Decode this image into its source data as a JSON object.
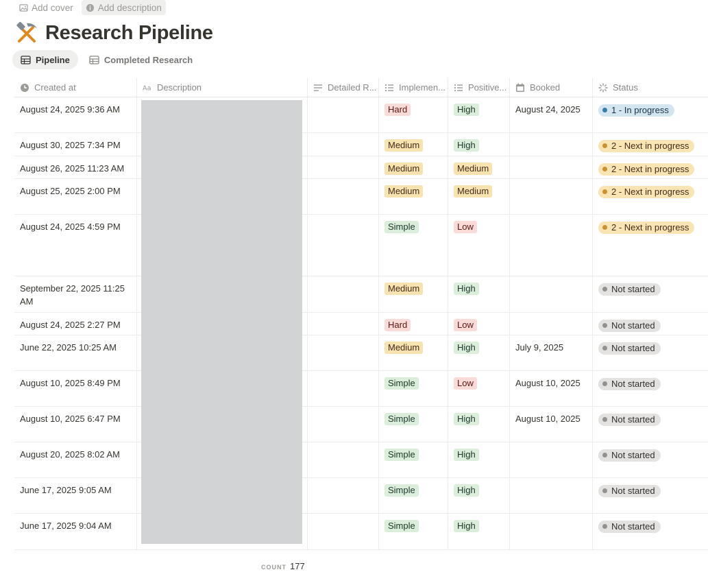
{
  "page_actions": {
    "add_cover": "Add cover",
    "add_description": "Add description"
  },
  "page": {
    "title": "Research Pipeline",
    "icon": "hammer-and-pick-icon"
  },
  "views": [
    {
      "label": "Pipeline",
      "active": true
    },
    {
      "label": "Completed Research",
      "active": false
    }
  ],
  "columns": [
    {
      "label": "Created at",
      "icon": "clock-icon"
    },
    {
      "label": "Description",
      "icon": "text-aa-icon"
    },
    {
      "label": "Detailed R...",
      "icon": "text-lines-icon"
    },
    {
      "label": "Implemen...",
      "icon": "list-icon"
    },
    {
      "label": "Positive...",
      "icon": "list-icon"
    },
    {
      "label": "Booked",
      "icon": "calendar-icon"
    },
    {
      "label": "Status",
      "icon": "status-spinner-icon"
    }
  ],
  "rows": [
    {
      "created": "August 24, 2025 9:36 AM",
      "impl": "Hard",
      "positive": "High",
      "booked": "August 24, 2025",
      "status": "1 - In progress"
    },
    {
      "created": "August 30, 2025 7:34 PM",
      "impl": "Medium",
      "positive": "High",
      "booked": "",
      "status": "2 - Next in progress"
    },
    {
      "created": "August 26, 2025 11:23 AM",
      "impl": "Medium",
      "positive": "Medium",
      "booked": "",
      "status": "2 - Next in progress"
    },
    {
      "created": "August 25, 2025 2:00 PM",
      "impl": "Medium",
      "positive": "Medium",
      "booked": "",
      "status": "2 - Next in progress"
    },
    {
      "created": "August 24, 2025 4:59 PM",
      "impl": "Simple",
      "positive": "Low",
      "booked": "",
      "status": "2 - Next in progress"
    },
    {
      "created": "September 22, 2025 11:25 AM",
      "impl": "Medium",
      "positive": "High",
      "booked": "",
      "status": "Not started"
    },
    {
      "created": "August 24, 2025 2:27 PM",
      "impl": "Hard",
      "positive": "Low",
      "booked": "",
      "status": "Not started"
    },
    {
      "created": "June 22, 2025 10:25 AM",
      "impl": "Medium",
      "positive": "High",
      "booked": "July 9, 2025",
      "status": "Not started"
    },
    {
      "created": "August 10, 2025 8:49 PM",
      "impl": "Simple",
      "positive": "Low",
      "booked": "August 10, 2025",
      "status": "Not started"
    },
    {
      "created": "August 10, 2025 6:47 PM",
      "impl": "Simple",
      "positive": "High",
      "booked": "August 10, 2025",
      "status": "Not started"
    },
    {
      "created": "August 20, 2025 8:02 AM",
      "impl": "Simple",
      "positive": "High",
      "booked": "",
      "status": "Not started"
    },
    {
      "created": "June 17, 2025 9:05 AM",
      "impl": "Simple",
      "positive": "High",
      "booked": "",
      "status": "Not started"
    },
    {
      "created": "June 17, 2025 9:04 AM",
      "impl": "Simple",
      "positive": "High",
      "booked": "",
      "status": "Not started"
    }
  ],
  "footer": {
    "count_label": "COUNT",
    "count_value": "177"
  },
  "colors": {
    "status_in_progress": "#337ea9",
    "status_next": "#cb912f",
    "status_not_started": "#91918e",
    "tag_red_bg": "#fadbd8",
    "tag_yellow_bg": "#f7e3b0",
    "tag_green_bg": "#dbeddb"
  }
}
